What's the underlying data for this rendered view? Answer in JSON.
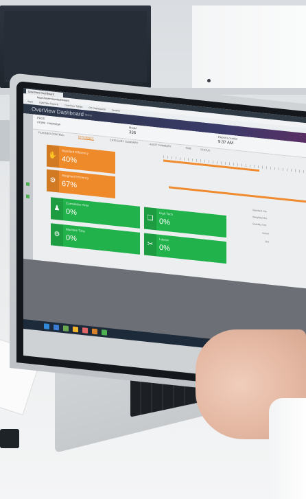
{
  "browser": {
    "tab_title": "OverView Dashboard",
    "address": "https://overviewdashboard",
    "bookmarks": [
      "Apps",
      "OverView Reports",
      "OverView Tables",
      "OT Dashboards",
      "Spotfire"
    ]
  },
  "app": {
    "title": "OverView Dashboard",
    "menu": "Menu"
  },
  "info_bar": {
    "site": "PROD",
    "sub": "STORE · OVERVIEW",
    "count_label": "Model",
    "count_value": "336",
    "time_label": "Report Location",
    "time_value": "9:37 AM"
  },
  "tabs": [
    {
      "label": "PLANNED CONTROL",
      "active": false
    },
    {
      "label": "EFFICIENCY",
      "active": true
    },
    {
      "label": "CATEGORY SUMMARY",
      "active": false
    },
    {
      "label": "AUDIT SUMMARY",
      "active": false
    },
    {
      "label": "TIME",
      "active": false
    },
    {
      "label": "STATUS",
      "active": false
    }
  ],
  "tiles": [
    {
      "label": "Standard Efficiency",
      "value": "40%",
      "color": "#ef8a2a",
      "icon": "hand-icon"
    },
    {
      "label": "Weighted Efficiency",
      "value": "67%",
      "color": "#ef8a2a",
      "icon": "gear-icon"
    },
    {
      "label": "Cumulative Time",
      "value": "0%",
      "color": "#22b24c",
      "icon": "person-icon"
    },
    {
      "label": "High Tech",
      "value": "0%",
      "color": "#22b24c",
      "icon": "tag-icon"
    },
    {
      "label": "Machine Time",
      "value": "0%",
      "color": "#22b24c",
      "icon": "gear-icon"
    },
    {
      "label": "Labour",
      "value": "0%",
      "color": "#22b24c",
      "icon": "tool-icon"
    }
  ],
  "stats": [
    "Standard Hrs",
    "Weighted Hrs",
    "Quantity Ord",
    "Actual",
    "Unit"
  ]
}
